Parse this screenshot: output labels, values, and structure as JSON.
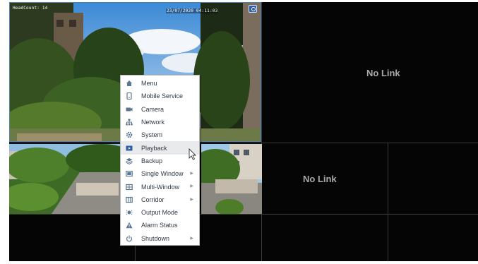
{
  "camera1": {
    "headcount_label": "HeadCount: 14",
    "timestamp": "23/07/2020 04:11:03"
  },
  "channels": {
    "no_link_1": "No Link",
    "no_link_2": "No Link"
  },
  "menu": {
    "items": [
      {
        "label": "Menu",
        "icon": "home-icon",
        "submenu": false
      },
      {
        "label": "Mobile Service",
        "icon": "mobile-icon",
        "submenu": false
      },
      {
        "label": "Camera",
        "icon": "camera-icon",
        "submenu": false
      },
      {
        "label": "Network",
        "icon": "network-icon",
        "submenu": false
      },
      {
        "label": "System",
        "icon": "gear-icon",
        "submenu": false
      },
      {
        "label": "Playback",
        "icon": "play-icon",
        "submenu": false,
        "highlighted": true
      },
      {
        "label": "Backup",
        "icon": "stack-icon",
        "submenu": false
      },
      {
        "label": "Single Window",
        "icon": "single-window-icon",
        "submenu": true
      },
      {
        "label": "Multi-Window",
        "icon": "multi-window-icon",
        "submenu": true
      },
      {
        "label": "Corridor",
        "icon": "corridor-icon",
        "submenu": true
      },
      {
        "label": "Output Mode",
        "icon": "output-mode-icon",
        "submenu": false
      },
      {
        "label": "Alarm Status",
        "icon": "alarm-icon",
        "submenu": false
      },
      {
        "label": "Shutdown",
        "icon": "power-icon",
        "submenu": true
      }
    ]
  },
  "colors": {
    "accent": "#2f5da8",
    "menu_icon": "#5d7690",
    "tile_border": "#4a7fb8"
  }
}
